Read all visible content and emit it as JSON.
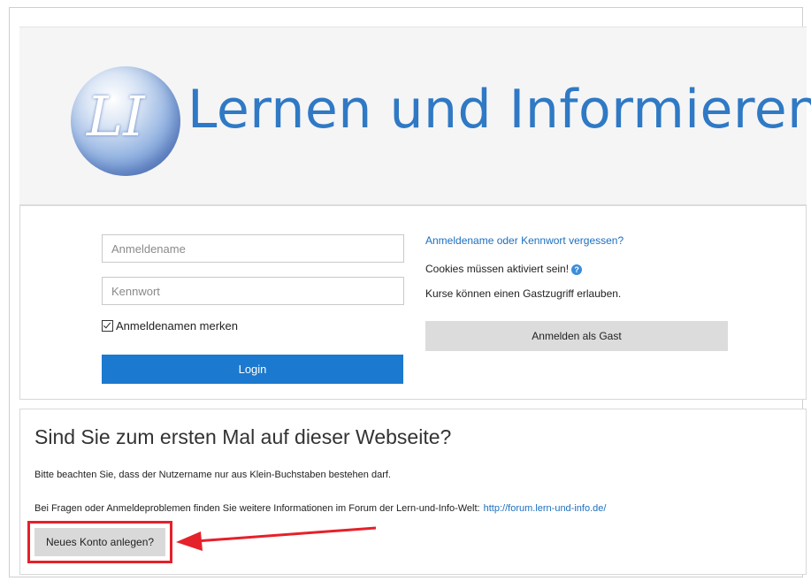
{
  "header": {
    "logo_letters": "LI",
    "site_name": "Lernen und Informieren"
  },
  "login": {
    "username_placeholder": "Anmeldename",
    "password_placeholder": "Kennwort",
    "remember_label": "Anmeldenamen merken",
    "remember_checked": true,
    "login_button": "Login",
    "forgot_link": "Anmeldename oder Kennwort vergessen?",
    "cookies_text": "Cookies müssen aktiviert sein!",
    "guest_text": "Kurse können einen Gastzugriff erlauben.",
    "guest_button": "Anmelden als Gast"
  },
  "signup": {
    "title": "Sind Sie zum ersten Mal auf dieser Webseite?",
    "note_username": "Bitte beachten Sie, dass der Nutzername nur aus Klein-Buchstaben bestehen darf.",
    "note_forum": "Bei Fragen oder Anmeldeproblemen finden Sie weitere Informationen im Forum der Lern-und-Info-Welt:",
    "forum_link": "http://forum.lern-und-info.de/",
    "new_account_button": "Neues Konto anlegen?"
  },
  "colors": {
    "accent": "#1b79cf",
    "link": "#1d6fbf",
    "annotation_red": "#e5212a"
  },
  "icons": {
    "help": "help-icon",
    "checkbox": "checkbox-checked-icon"
  }
}
